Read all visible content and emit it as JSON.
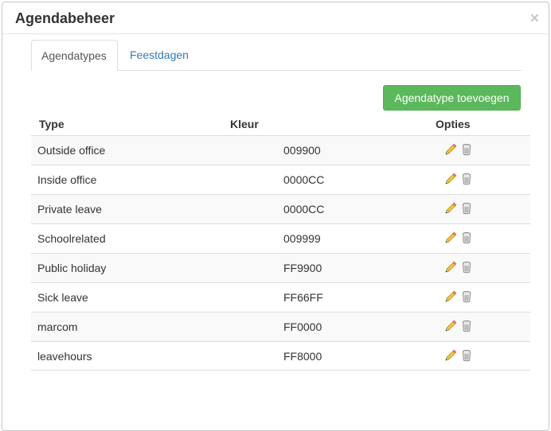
{
  "modal": {
    "title": "Agendabeheer",
    "close_label": "×"
  },
  "tabs": [
    {
      "label": "Agendatypes",
      "active": true
    },
    {
      "label": "Feestdagen",
      "active": false
    }
  ],
  "toolbar": {
    "add_label": "Agendatype toevoegen"
  },
  "table": {
    "headers": {
      "type": "Type",
      "color": "Kleur",
      "options": "Opties"
    },
    "rows": [
      {
        "type": "Outside office",
        "color": "009900"
      },
      {
        "type": "Inside office",
        "color": "0000CC"
      },
      {
        "type": "Private leave",
        "color": "0000CC"
      },
      {
        "type": "Schoolrelated",
        "color": "009999"
      },
      {
        "type": "Public holiday",
        "color": "FF9900"
      },
      {
        "type": "Sick leave",
        "color": "FF66FF"
      },
      {
        "type": "marcom",
        "color": "FF0000"
      },
      {
        "type": "leavehours",
        "color": "FF8000"
      }
    ]
  },
  "icons": {
    "edit": "pencil-icon",
    "delete": "trash-icon"
  },
  "colors": {
    "primary_link": "#337ab7",
    "success": "#5cb85c",
    "row_stripe": "#f9f9f9"
  }
}
